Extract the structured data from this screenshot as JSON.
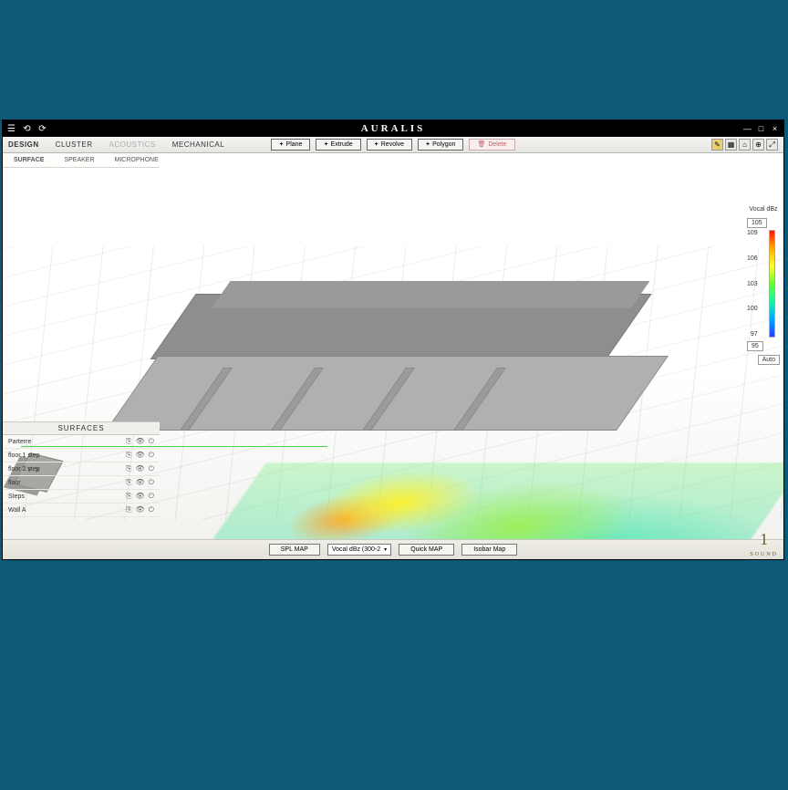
{
  "app": {
    "title": "AURALIS",
    "window_controls": {
      "min": "—",
      "restore": "□",
      "close": "×"
    }
  },
  "titlebar_icons": [
    "menu",
    "undo-rotate",
    "redo-rotate"
  ],
  "main_tabs": [
    {
      "label": "DESIGN",
      "active": true
    },
    {
      "label": "CLUSTER",
      "active": false
    },
    {
      "label": "ACOUSTICS",
      "active": false,
      "dim": true
    },
    {
      "label": "MECHANICAL",
      "active": false
    }
  ],
  "create_tools": [
    {
      "label": "Plane"
    },
    {
      "label": "Extrude"
    },
    {
      "label": "Revolve"
    },
    {
      "label": "Polygon"
    }
  ],
  "delete_label": "Delete",
  "view_buttons": [
    "measure",
    "grid",
    "home",
    "target",
    "expand"
  ],
  "sub_tabs": [
    {
      "label": "SURFACE",
      "active": true
    },
    {
      "label": "SPEAKER",
      "active": false
    },
    {
      "label": "MICROPHONE",
      "active": false
    }
  ],
  "legend": {
    "title": "Vocal dBz",
    "max": "105",
    "ticks": [
      "109",
      "106",
      "103",
      "100",
      "97"
    ],
    "min": "95",
    "auto": "Auto"
  },
  "surfaces": {
    "title": "SURFACES",
    "items": [
      {
        "name": "Parterre"
      },
      {
        "name": "floor 1 step"
      },
      {
        "name": "floor 2 step"
      },
      {
        "name": "floor"
      },
      {
        "name": "Steps"
      },
      {
        "name": "Wall A"
      }
    ]
  },
  "bottombar": {
    "spl_map": "SPL MAP",
    "select_value": "Vocal dBz (300-2",
    "quick_map": "Quick MAP",
    "isobar": "Isobar Map"
  },
  "brand": {
    "num": "1",
    "word": "SOUND"
  }
}
